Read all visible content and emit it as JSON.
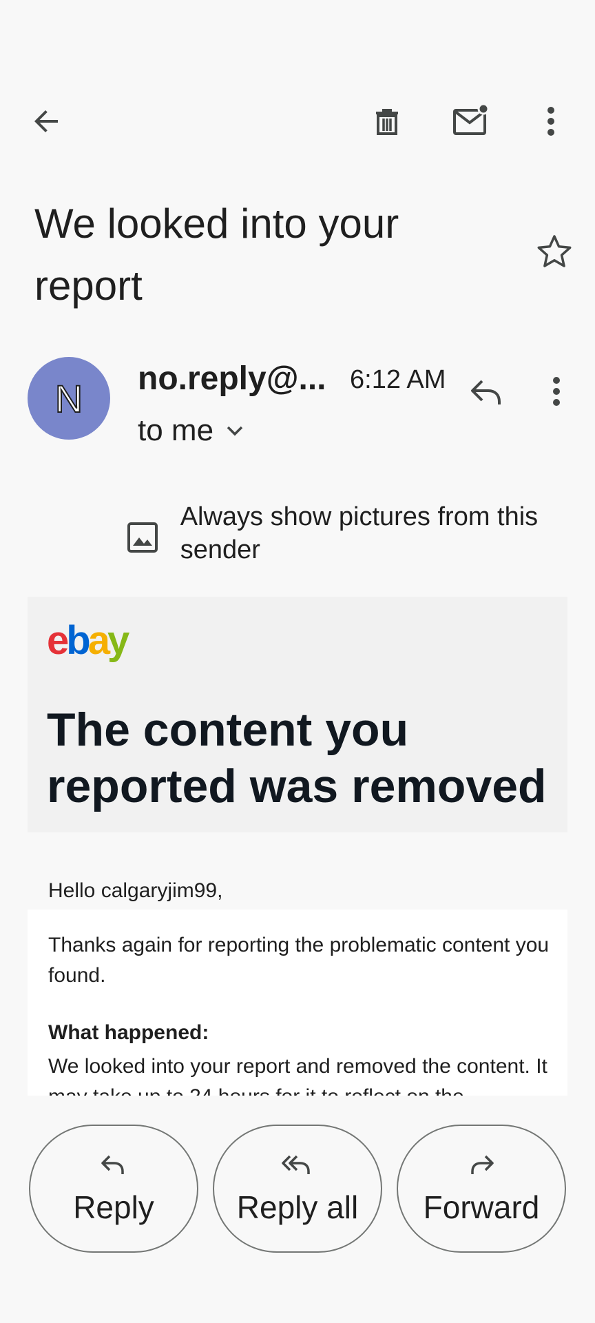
{
  "toolbar": {
    "back_icon": "arrow-back-icon",
    "delete_icon": "trash-icon",
    "mark_unread_icon": "mail-unread-icon",
    "more_icon": "more-vert-icon"
  },
  "message": {
    "subject": "We looked into your report",
    "starred": false,
    "sender": {
      "initial": "N",
      "name": "no.reply@...",
      "avatar_color": "#7986cb"
    },
    "time": "6:12 AM",
    "recipient": "to me",
    "pictures_notice": "Always show pictures from this sender"
  },
  "body": {
    "logo": {
      "e": "e",
      "b": "b",
      "a": "a",
      "y": "y"
    },
    "headline": "The content you reported was removed",
    "greeting": "Hello calgaryjim99,",
    "intro": "Thanks again for reporting the problematic content you found.",
    "section_title": "What happened:",
    "section_text": "We looked into your report and removed the content. It may take up to 24 hours for it to reflect on the"
  },
  "actions": {
    "reply": "Reply",
    "reply_all": "Reply all",
    "forward": "Forward"
  },
  "colors": {
    "background": "#f8f8f8",
    "text": "#1f1f1f",
    "headline": "#111820",
    "ebay_red": "#e53238",
    "ebay_blue": "#0064d2",
    "ebay_yellow": "#f5af02",
    "ebay_green": "#86b817"
  }
}
